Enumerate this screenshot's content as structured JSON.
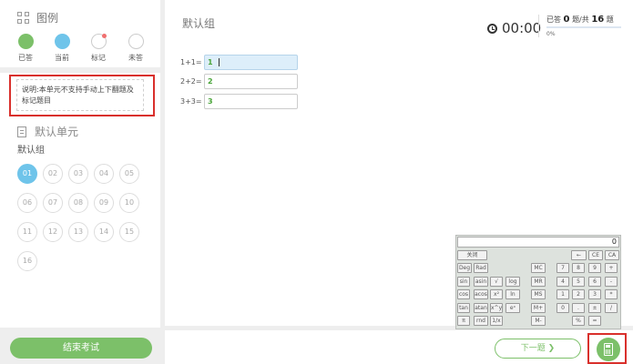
{
  "legend": {
    "title": "图例",
    "items": [
      {
        "label": "已答",
        "state": "answered"
      },
      {
        "label": "当前",
        "state": "current"
      },
      {
        "label": "标记",
        "state": "marked"
      },
      {
        "label": "未答",
        "state": "unanswered"
      }
    ],
    "colors": {
      "answered": "#7cc069",
      "current": "#6fc4ea",
      "mark_flag": "#f07070"
    }
  },
  "note": "说明:本单元不支持手动上下翻题及标记题目",
  "unit": {
    "title": "默认单元",
    "group": "默认组",
    "questions": [
      "01",
      "02",
      "03",
      "04",
      "05",
      "06",
      "07",
      "08",
      "09",
      "10",
      "11",
      "12",
      "13",
      "14",
      "15",
      "16"
    ],
    "current": "01"
  },
  "end_button": "结束考试",
  "main": {
    "title": "默认组",
    "timer": "00:00",
    "progress": {
      "answered": "0",
      "total": "16",
      "text_prefix": "已答",
      "text_mid": "题/共",
      "text_suffix": "题",
      "percent_label": "0%",
      "fraction": 0
    },
    "questions": [
      {
        "label": "1+1=",
        "value": "1",
        "active": true
      },
      {
        "label": "2+2=",
        "value": "2",
        "active": false
      },
      {
        "label": "3+3=",
        "value": "3",
        "active": false
      }
    ]
  },
  "calculator": {
    "display": "0",
    "close": "关闭",
    "keys": {
      "back": "←",
      "ce": "CE",
      "ca": "CA",
      "deg": "Deg",
      "rad": "Rad",
      "mc": "MC",
      "mr": "MR",
      "ms": "MS",
      "mplus": "M+",
      "mminus": "M-",
      "sin": "sin",
      "asin": "asin",
      "sqrt": "√",
      "log": "log",
      "cos": "cos",
      "acos": "acos",
      "x2": "x²",
      "ln": "ln",
      "tan": "tan",
      "atan": "atan",
      "xy": "x^y",
      "ex": "eˣ",
      "pi": "π",
      "rnd": "rnd",
      "inv": "1/x",
      "n7": "7",
      "n8": "8",
      "n9": "9",
      "plus": "+",
      "n4": "4",
      "n5": "5",
      "n6": "6",
      "minus": "-",
      "n1": "1",
      "n2": "2",
      "n3": "3",
      "mul": "*",
      "n0": "0",
      "dot": ".",
      "pm": "±",
      "div": "/",
      "pct": "%",
      "eq": "="
    }
  },
  "next_button": "下一题"
}
